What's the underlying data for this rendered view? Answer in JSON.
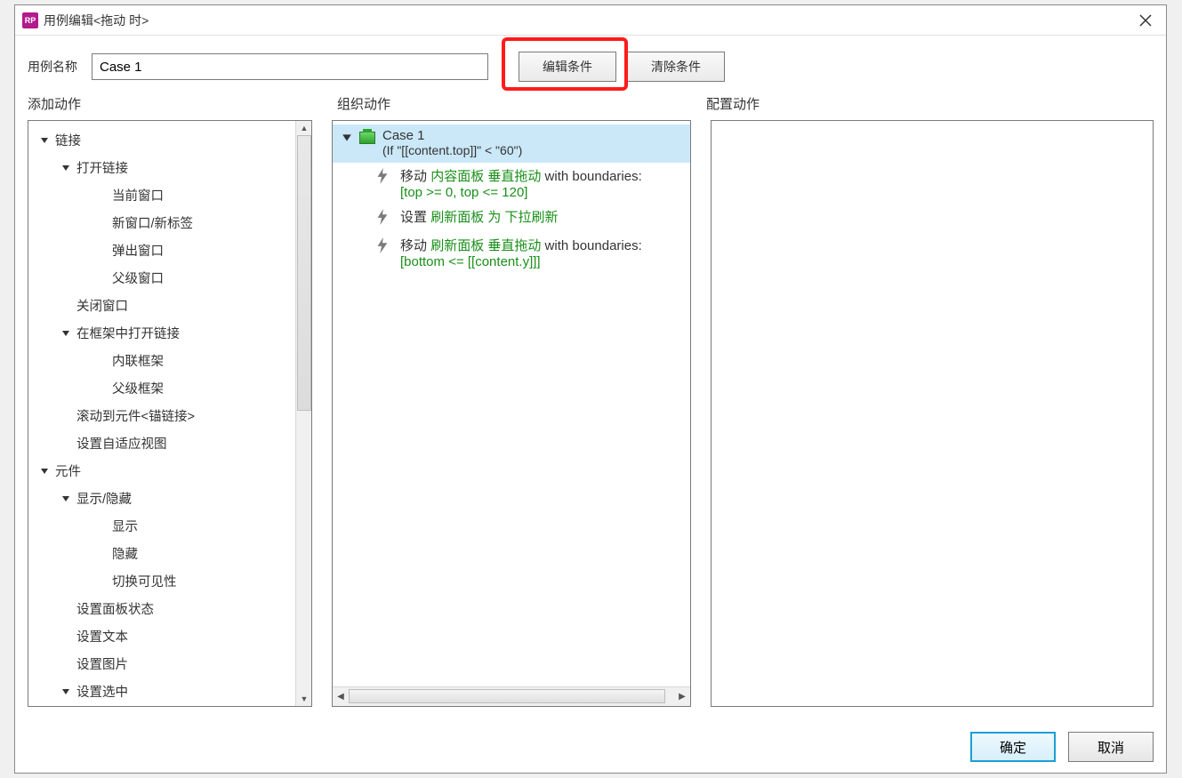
{
  "window": {
    "title": "用例编辑<拖动 时>",
    "app_icon_text": "RP"
  },
  "labels": {
    "case_name": "用例名称",
    "edit_condition": "编辑条件",
    "clear_condition": "清除条件",
    "add_action": "添加动作",
    "organize_action": "组织动作",
    "configure_action": "配置动作",
    "ok": "确定",
    "cancel": "取消"
  },
  "case": {
    "name": "Case 1",
    "condition": "(If \"[[content.top]]\" < \"60\")"
  },
  "tree": [
    {
      "label": "链接",
      "indent": 0,
      "expanded": true
    },
    {
      "label": "打开链接",
      "indent": 1,
      "expanded": true
    },
    {
      "label": "当前窗口",
      "indent": 2
    },
    {
      "label": "新窗口/新标签",
      "indent": 2
    },
    {
      "label": "弹出窗口",
      "indent": 2
    },
    {
      "label": "父级窗口",
      "indent": 2
    },
    {
      "label": "关闭窗口",
      "indent": 1
    },
    {
      "label": "在框架中打开链接",
      "indent": 1,
      "expanded": true
    },
    {
      "label": "内联框架",
      "indent": 2
    },
    {
      "label": "父级框架",
      "indent": 2
    },
    {
      "label": "滚动到元件<锚链接>",
      "indent": 1
    },
    {
      "label": "设置自适应视图",
      "indent": 1
    },
    {
      "label": "元件",
      "indent": 0,
      "expanded": true
    },
    {
      "label": "显示/隐藏",
      "indent": 1,
      "expanded": true
    },
    {
      "label": "显示",
      "indent": 2
    },
    {
      "label": "隐藏",
      "indent": 2
    },
    {
      "label": "切换可见性",
      "indent": 2
    },
    {
      "label": "设置面板状态",
      "indent": 1
    },
    {
      "label": "设置文本",
      "indent": 1
    },
    {
      "label": "设置图片",
      "indent": 1
    },
    {
      "label": "设置选中",
      "indent": 1,
      "expanded": true
    }
  ],
  "actions": [
    {
      "verb": "移动",
      "target": "内容面板 垂直拖动",
      "suffix": " with boundaries:",
      "detail": "[top >= 0, top <= 120]"
    },
    {
      "verb": "设置",
      "target": "刷新面板 为 下拉刷新",
      "suffix": "",
      "detail": ""
    },
    {
      "verb": "移动",
      "target": "刷新面板 垂直拖动",
      "suffix": " with boundaries:",
      "detail": "[bottom <= [[content.y]]]"
    }
  ]
}
